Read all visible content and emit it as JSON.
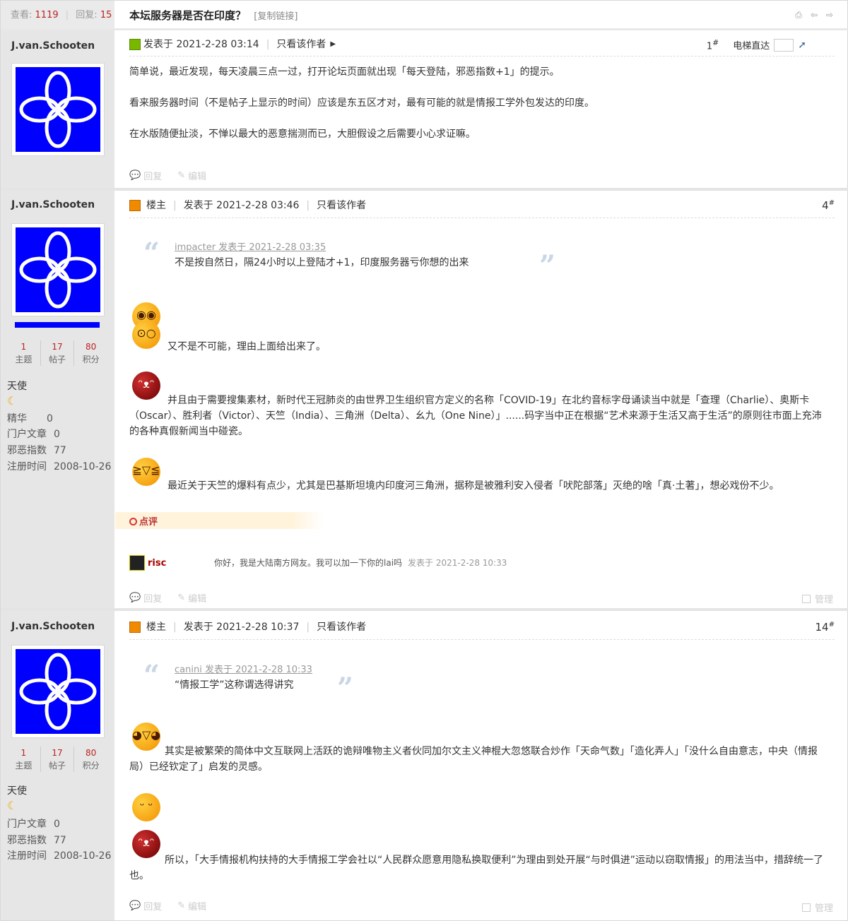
{
  "thread": {
    "views_label": "查看:",
    "views": "1119",
    "replies_label": "回复:",
    "replies": "15",
    "title": "本坛服务器是否在印度？",
    "copy_link": "[复制链接]"
  },
  "posts": [
    {
      "author": "J.van.Schooten",
      "posted_label": "发表于 2021-2-28 03:14",
      "only_author": "只看该作者",
      "floor": "1",
      "elevator": "电梯直达",
      "paragraphs": [
        "简单说，最近发现，每天凌晨三点一过，打开论坛页面就出现「每天登陆，邪恶指数+1」的提示。",
        "看来服务器时间（不是帖子上显示的时间）应该是东五区才对，最有可能的就是情报工学外包发达的印度。",
        "在水版随便扯淡，不惮以最大的恶意揣测而已，大胆假设之后需要小心求证嘛。"
      ],
      "reply": "回复",
      "edit": "编辑"
    },
    {
      "author": "J.van.Schooten",
      "op_label": "楼主",
      "posted_label": "发表于 2021-2-28 03:46",
      "only_author": "只看该作者",
      "floor": "4",
      "quote_head": "impacter 发表于 2021-2-28 03:35",
      "quote_body": "不是按自然日，隔24小时以上登陆才+1，印度服务器亏你想的出来",
      "p1": "又不是不可能，理由上面给出来了。",
      "p2": "并且由于需要搜集素材，新时代王冠肺炎的由世界卫生组织官方定义的名称「COVID-19」在北约音标字母诵读当中就是「查理（Charlie）、奥斯卡（Oscar）、胜利者（Victor）、天竺（India）、三角洲（Delta）、幺九（One Nine）」......码字当中正在根据“艺术来源于生活又高于生活”的原则往市面上充沛的各种真假新闻当中碰瓷。",
      "p3": "最近关于天竺的爆料有点少，尤其是巴基斯坦境内印度河三角洲，据称是被雅利安入侵者「吠陀部落」灭绝的啥「真·土著」，想必戏份不少。",
      "comment_label": "点评",
      "comment_user": "risc",
      "comment_text": "你好，我是大陆南方网友。我可以加一下你的lai吗",
      "comment_time": "发表于 2021-2-28 10:33",
      "reply": "回复",
      "edit": "编辑",
      "manage": "管理",
      "stats": [
        {
          "value": "1",
          "label": "主题"
        },
        {
          "value": "17",
          "label": "帖子"
        },
        {
          "value": "80",
          "label": "积分"
        }
      ],
      "rank": "天使",
      "info": [
        {
          "label": "精华",
          "value": "0"
        },
        {
          "label": "门户文章",
          "value": "0"
        },
        {
          "label": "邪恶指数",
          "value": "77"
        },
        {
          "label": "注册时间",
          "value": "2008-10-26"
        }
      ]
    },
    {
      "author": "J.van.Schooten",
      "op_label": "楼主",
      "posted_label": "发表于 2021-2-28 10:37",
      "only_author": "只看该作者",
      "floor": "14",
      "quote_head": "canini 发表于 2021-2-28 10:33",
      "quote_body": "“情报工学”这称谓选得讲究",
      "p1": "其实是被繁荣的简体中文互联网上活跃的诡辩唯物主义者伙同加尔文主义神棍大忽悠联合炒作「天命气数」「造化弄人」「没什么自由意志，中央（情报局）已经钦定了」启发的灵感。",
      "p2": "所以，「大手情报机构扶持的大手情报工学会社以“人民群众愿意用隐私换取便利”为理由到处开展“与时俱进”运动以窃取情报」的用法当中，措辞统一了也。",
      "reply": "回复",
      "edit": "编辑",
      "manage": "管理",
      "stats": [
        {
          "value": "1",
          "label": "主题"
        },
        {
          "value": "17",
          "label": "帖子"
        },
        {
          "value": "80",
          "label": "积分"
        }
      ],
      "rank": "天使",
      "info": [
        {
          "label": "门户文章",
          "value": "0"
        },
        {
          "label": "邪恶指数",
          "value": "77"
        },
        {
          "label": "注册时间",
          "value": "2008-10-26"
        }
      ]
    }
  ]
}
